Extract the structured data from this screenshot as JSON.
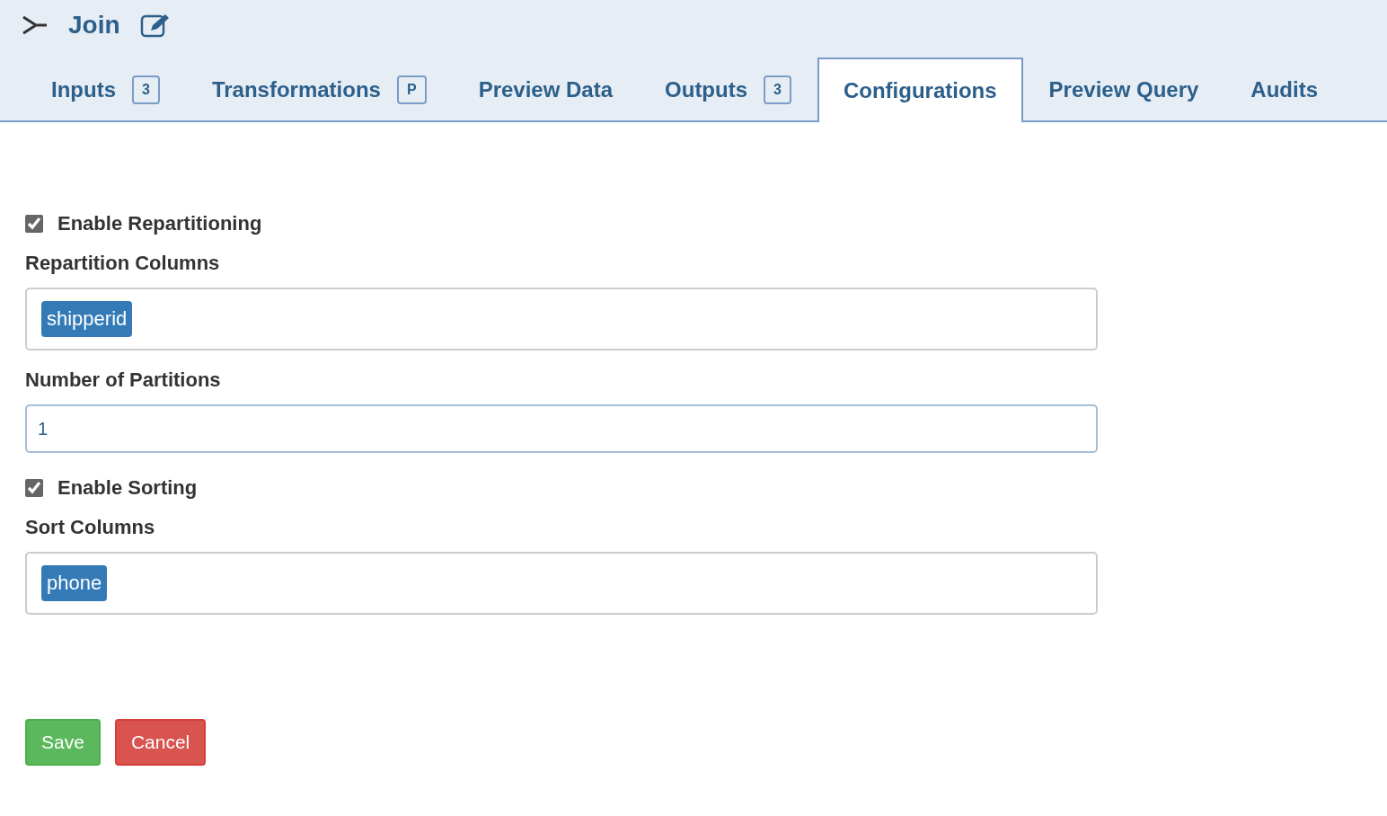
{
  "header": {
    "title": "Join"
  },
  "tabs": [
    {
      "label": "Inputs",
      "badge": "3",
      "selected": false
    },
    {
      "label": "Transformations",
      "badge": "P",
      "selected": false
    },
    {
      "label": "Preview Data",
      "selected": false
    },
    {
      "label": "Outputs",
      "badge": "3",
      "selected": false
    },
    {
      "label": "Configurations",
      "selected": true
    },
    {
      "label": "Preview Query",
      "selected": false
    },
    {
      "label": "Audits",
      "selected": false
    }
  ],
  "form": [
    {
      "kind": "checkbox",
      "label": "Enable Repartitioning",
      "checked": true
    },
    {
      "kind": "tags",
      "label": "Repartition Columns",
      "tags": [
        "shipperid"
      ]
    },
    {
      "kind": "input",
      "label": "Number of Partitions",
      "value": "1"
    },
    {
      "kind": "checkbox",
      "label": "Enable Sorting",
      "checked": true
    },
    {
      "kind": "tags",
      "label": "Sort Columns",
      "tags": [
        "phone"
      ]
    }
  ],
  "buttons": [
    {
      "kind": "save",
      "label": "Save"
    },
    {
      "kind": "cancel",
      "label": "Cancel"
    }
  ]
}
